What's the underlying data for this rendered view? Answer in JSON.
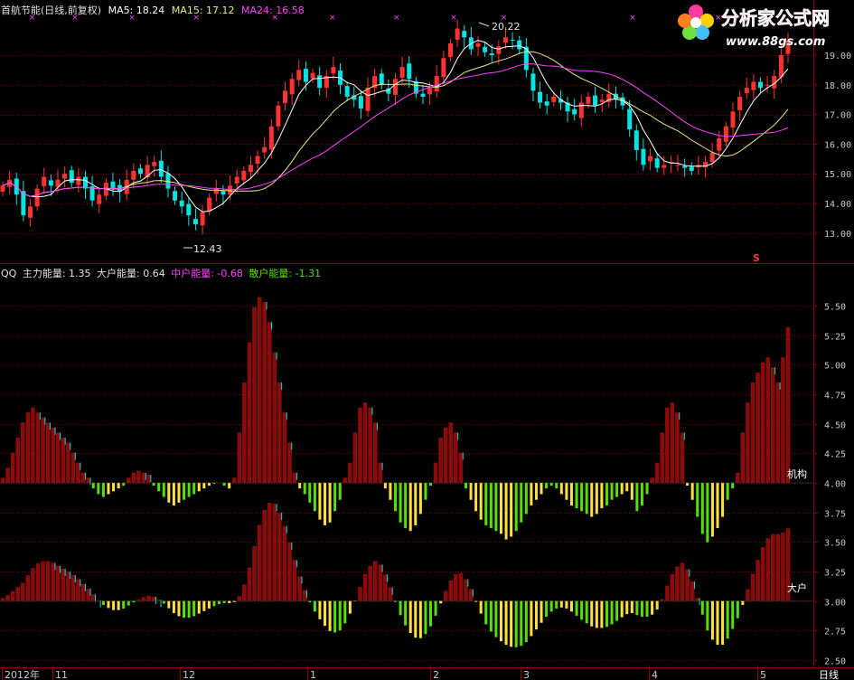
{
  "upper_header": {
    "title": "首航节能(日线,前复权)",
    "ma5": "MA5: 18.24",
    "ma15": "MA15: 17.12",
    "ma24": "MA24: 16.58"
  },
  "lower_header": {
    "name": "QQ",
    "main": "主力能量: 1.35",
    "big": "大户能量: 0.64",
    "mid": "中户能量: -0.68",
    "retail": "散户能量: -1.31"
  },
  "logo": {
    "title": "分析家公式网",
    "url": "www.88gs.com"
  },
  "annotations": {
    "high": "20.22",
    "low": "12.43",
    "signal": "S",
    "jigou": "机构",
    "dahu": "大户"
  },
  "period": "日线",
  "colors": {
    "up": "#ff3232",
    "down": "#00e4e4",
    "ma5": "#ffffff",
    "ma15": "#e8e880",
    "ma24": "#ff40ff",
    "dark_red": "#8b0a0a",
    "green": "#55e000",
    "yellow": "#ffe040",
    "grid": "#8b0000"
  },
  "chart_data": [
    {
      "type": "line",
      "title": "首航节能(日线,前复权)",
      "y_ticks": [
        "19.00",
        "18.00",
        "17.00",
        "16.00",
        "15.00",
        "14.00",
        "13.00"
      ],
      "ylim": [
        12.4,
        20.6
      ],
      "x_ticks": [
        "2012年",
        "11",
        "12",
        "1",
        "2",
        "3",
        "4",
        "5"
      ],
      "series": [
        {
          "name": "MA5",
          "last": 18.24
        },
        {
          "name": "MA15",
          "last": 17.12
        },
        {
          "name": "MA24",
          "last": 16.58
        }
      ],
      "annotations": [
        {
          "label": "20.22"
        },
        {
          "label": "12.43"
        }
      ],
      "close": [
        14.6,
        14.8,
        14.3,
        13.6,
        13.9,
        14.5,
        14.9,
        14.6,
        14.8,
        15.0,
        14.7,
        14.9,
        14.5,
        14.1,
        14.3,
        14.7,
        14.5,
        14.4,
        14.8,
        15.1,
        15.0,
        15.3,
        15.4,
        14.9,
        14.5,
        14.1,
        13.9,
        13.6,
        13.3,
        13.7,
        14.2,
        14.5,
        14.3,
        14.6,
        14.9,
        15.1,
        15.3,
        15.6,
        15.9,
        16.6,
        17.3,
        17.8,
        18.2,
        18.5,
        18.1,
        18.4,
        17.9,
        18.3,
        18.6,
        18.0,
        17.6,
        17.5,
        17.2,
        17.9,
        18.3,
        18.0,
        17.7,
        18.2,
        18.6,
        18.2,
        17.7,
        17.6,
        17.9,
        18.3,
        18.9,
        19.4,
        19.9,
        19.6,
        19.2,
        19.4,
        19.1,
        19.0,
        19.3,
        19.6,
        19.5,
        19.2,
        18.5,
        17.8,
        17.4,
        17.3,
        17.6,
        17.4,
        17.1,
        17.0,
        17.4,
        17.6,
        17.3,
        17.5,
        17.7,
        17.5,
        17.3,
        16.5,
        15.8,
        15.3,
        15.6,
        15.2,
        15.3,
        15.4,
        15.3,
        15.2,
        15.1,
        15.3,
        15.4,
        15.7,
        16.2,
        16.6,
        17.1,
        17.6,
        17.9,
        18.1,
        17.9,
        18.0,
        18.3,
        19.0,
        19.5
      ]
    },
    {
      "type": "bar",
      "title": "QQ",
      "y_ticks": [
        "5.50",
        "5.25",
        "5.00",
        "4.75",
        "4.50",
        "4.25",
        "4.00",
        "3.75",
        "3.50",
        "3.25",
        "3.00",
        "2.75",
        "2.50"
      ],
      "ylim": [
        2.32,
        5.7
      ],
      "series": [
        {
          "name": "主力能量",
          "last": 1.35
        },
        {
          "name": "大户能量",
          "last": 0.64
        },
        {
          "name": "中户能量",
          "last": -0.68
        },
        {
          "name": "散户能量",
          "last": -1.31
        }
      ],
      "labels": [
        "机构",
        "大户"
      ],
      "baselines": [
        4.0,
        3.0
      ],
      "jigou": [
        0.05,
        0.15,
        0.3,
        0.45,
        0.6,
        0.7,
        0.75,
        0.7,
        0.65,
        0.6,
        0.55,
        0.5,
        0.45,
        0.4,
        0.3,
        0.2,
        0.1,
        0.05,
        -0.1,
        -0.2,
        -0.25,
        -0.2,
        -0.15,
        -0.1,
        -0.05,
        0.05,
        0.1,
        0.12,
        0.1,
        0.08,
        -0.05,
        -0.15,
        -0.25,
        -0.35,
        -0.4,
        -0.35,
        -0.3,
        -0.25,
        -0.2,
        -0.15,
        -0.1,
        -0.05,
        -0.02,
        0.0,
        -0.05,
        -0.1,
        0.05,
        0.5,
        1.0,
        1.4,
        1.75,
        1.85,
        1.8,
        1.6,
        1.3,
        1.0,
        0.7,
        0.4,
        0.1,
        -0.1,
        -0.2,
        -0.35,
        -0.5,
        -0.65,
        -0.75,
        -0.7,
        -0.5,
        -0.3,
        0.05,
        0.2,
        0.5,
        0.75,
        0.8,
        0.75,
        0.6,
        0.2,
        -0.1,
        -0.3,
        -0.5,
        -0.7,
        -0.8,
        -0.85,
        -0.75,
        -0.55,
        -0.3,
        -0.05,
        0.2,
        0.45,
        0.55,
        0.6,
        0.5,
        0.3,
        -0.1,
        -0.3,
        -0.5,
        -0.65,
        -0.75,
        -0.8,
        -0.85,
        -0.9,
        -1.0,
        -0.95,
        -0.85,
        -0.7,
        -0.55,
        -0.4,
        -0.3,
        -0.2,
        -0.1,
        -0.05,
        -0.1,
        -0.2,
        -0.3,
        -0.4,
        -0.45,
        -0.5,
        -0.55,
        -0.6,
        -0.55,
        -0.45,
        -0.4,
        -0.3,
        -0.25,
        -0.2,
        -0.15,
        -0.3,
        -0.5,
        -0.4,
        -0.2,
        0.05,
        0.2,
        0.5,
        0.75,
        0.8,
        0.7,
        0.5,
        -0.05,
        -0.3,
        -0.6,
        -0.9,
        -1.05,
        -0.95,
        -0.8,
        -0.6,
        -0.3,
        -0.1,
        0.1,
        0.5,
        0.8,
        1.0,
        1.1,
        1.2,
        1.25,
        1.15,
        1.0,
        1.25,
        1.55
      ]
    }
  ]
}
